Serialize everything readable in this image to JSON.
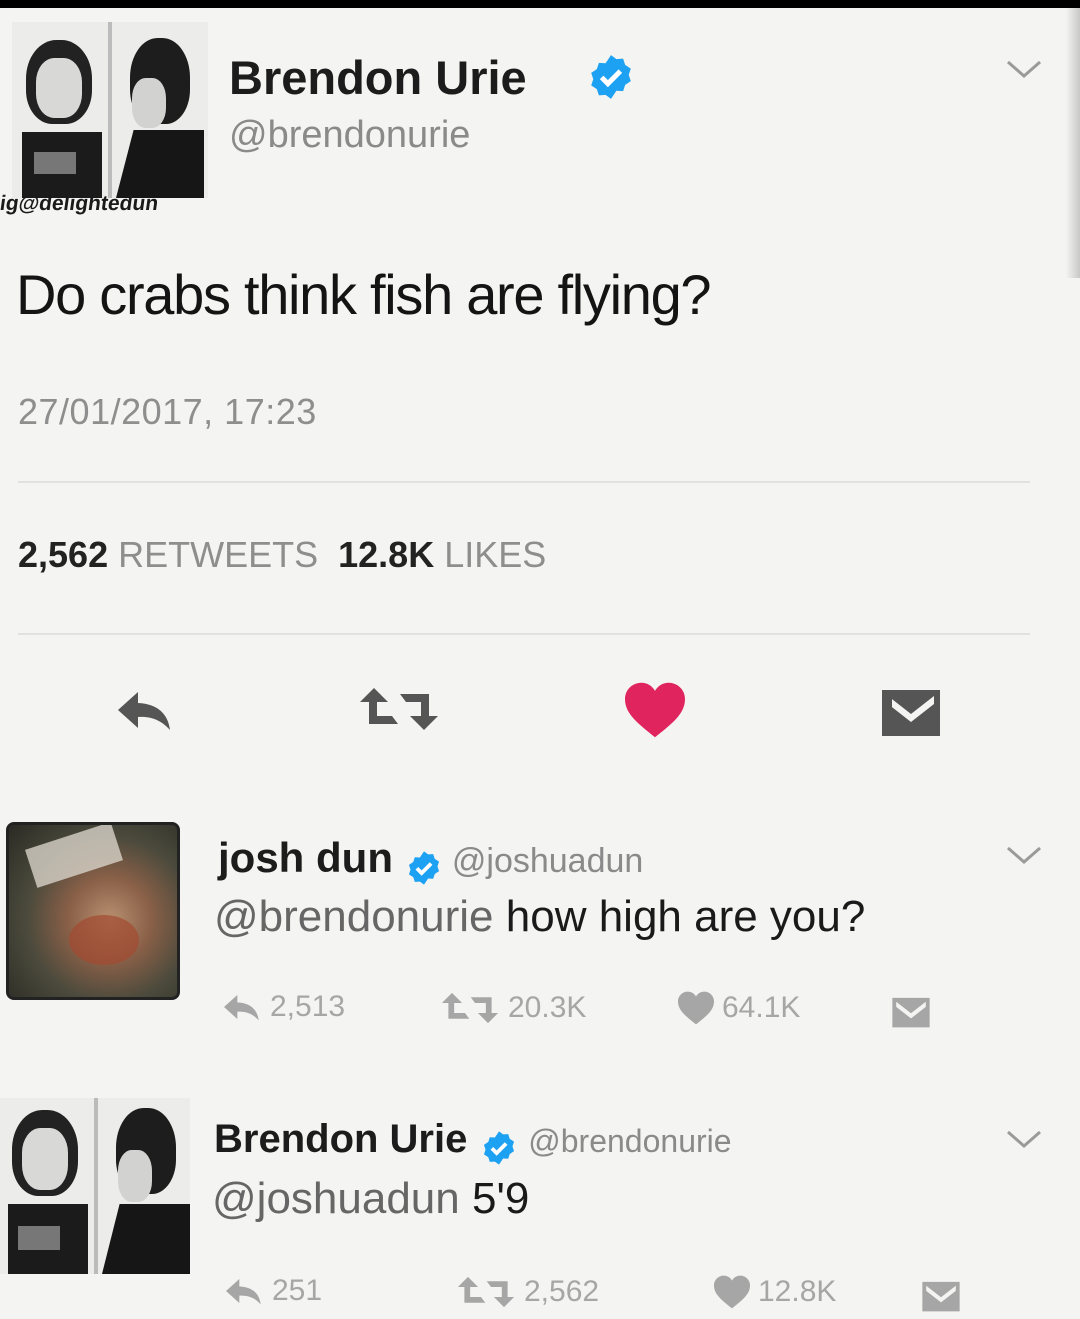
{
  "main_tweet": {
    "name": "Brendon Urie",
    "handle": "@brendonurie",
    "watermark": "ig@delightedun",
    "text": "Do crabs think fish are flying?",
    "timestamp": "27/01/2017, 17:23",
    "retweets_count": "2,562",
    "retweets_label": "RETWEETS",
    "likes_count": "12.8K",
    "likes_label": "LIKES",
    "liked": true
  },
  "replies": [
    {
      "name": "josh dun",
      "handle": "@joshuadun",
      "mention": "@brendonurie",
      "text": "how high are you?",
      "replies_count": "2,513",
      "retweets_count": "20.3K",
      "likes_count": "64.1K"
    },
    {
      "name": "Brendon Urie",
      "handle": "@brendonurie",
      "mention": "@joshuadun",
      "text": "5'9",
      "replies_count": "251",
      "retweets_count": "2,562",
      "likes_count": "12.8K"
    }
  ],
  "icons": {
    "verified": "verified-badge-icon",
    "reply": "reply-arrow-icon",
    "retweet": "retweet-icon",
    "like": "heart-icon",
    "message": "envelope-icon",
    "more": "chevron-down-icon"
  },
  "colors": {
    "verified": "#1da1f2",
    "like": "#e0245e",
    "muted": "#8e8e8e"
  }
}
